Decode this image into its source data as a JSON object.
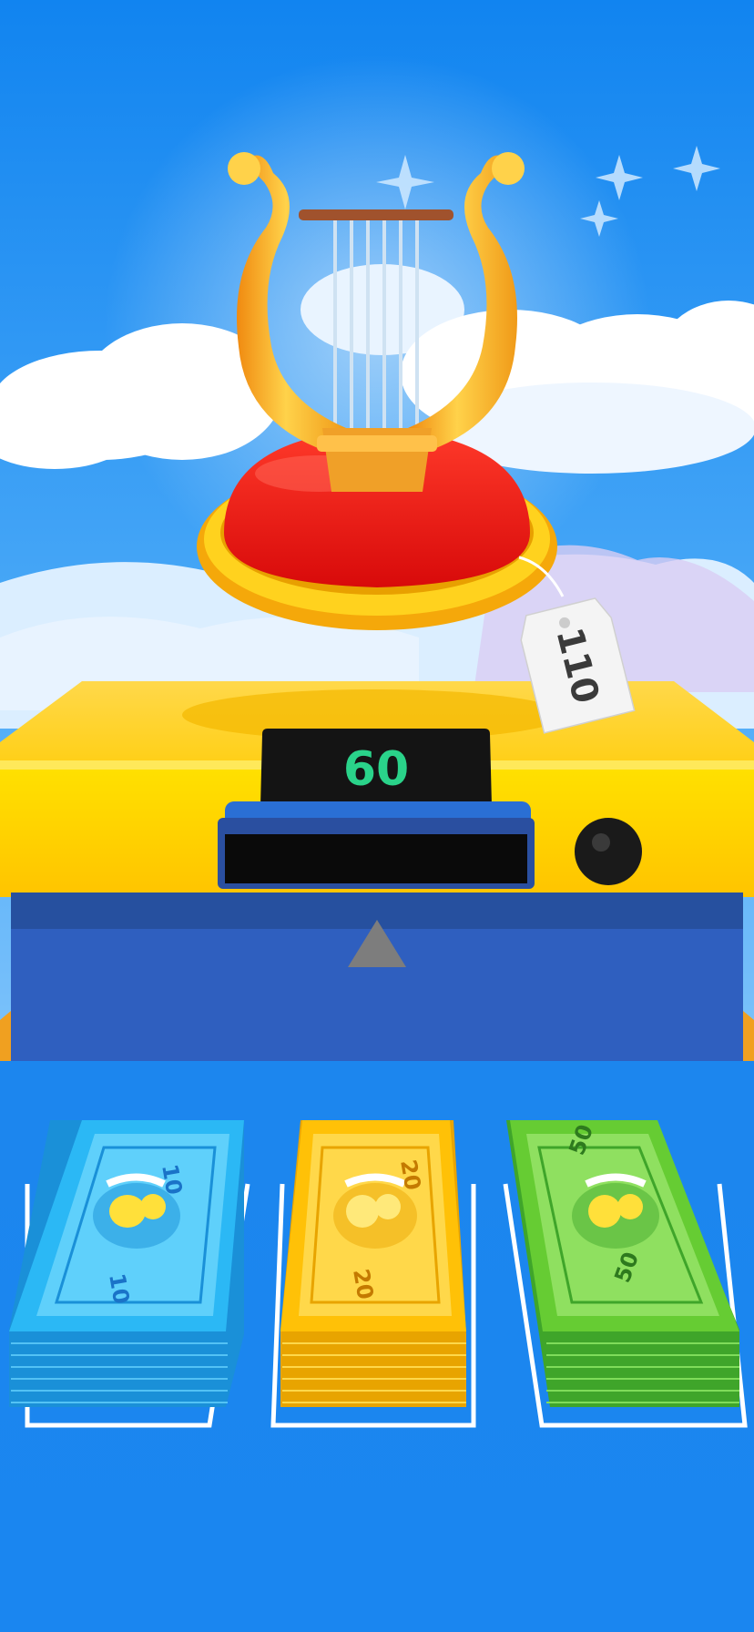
{
  "item": {
    "name": "lyre",
    "price_tag": "110"
  },
  "machine": {
    "display_value": "60"
  },
  "cash": {
    "stacks": [
      {
        "denomination": "10",
        "color": "#29b6f6"
      },
      {
        "denomination": "20",
        "color": "#ffc107"
      },
      {
        "denomination": "50",
        "color": "#66cc33"
      }
    ]
  },
  "colors": {
    "sky_top": "#1a8cf2",
    "counter_yellow": "#ffd400",
    "counter_blue": "#2f5fbf",
    "floor_blue": "#1a86f0",
    "cushion_red": "#ff1010",
    "gold": "#f5b21c"
  }
}
